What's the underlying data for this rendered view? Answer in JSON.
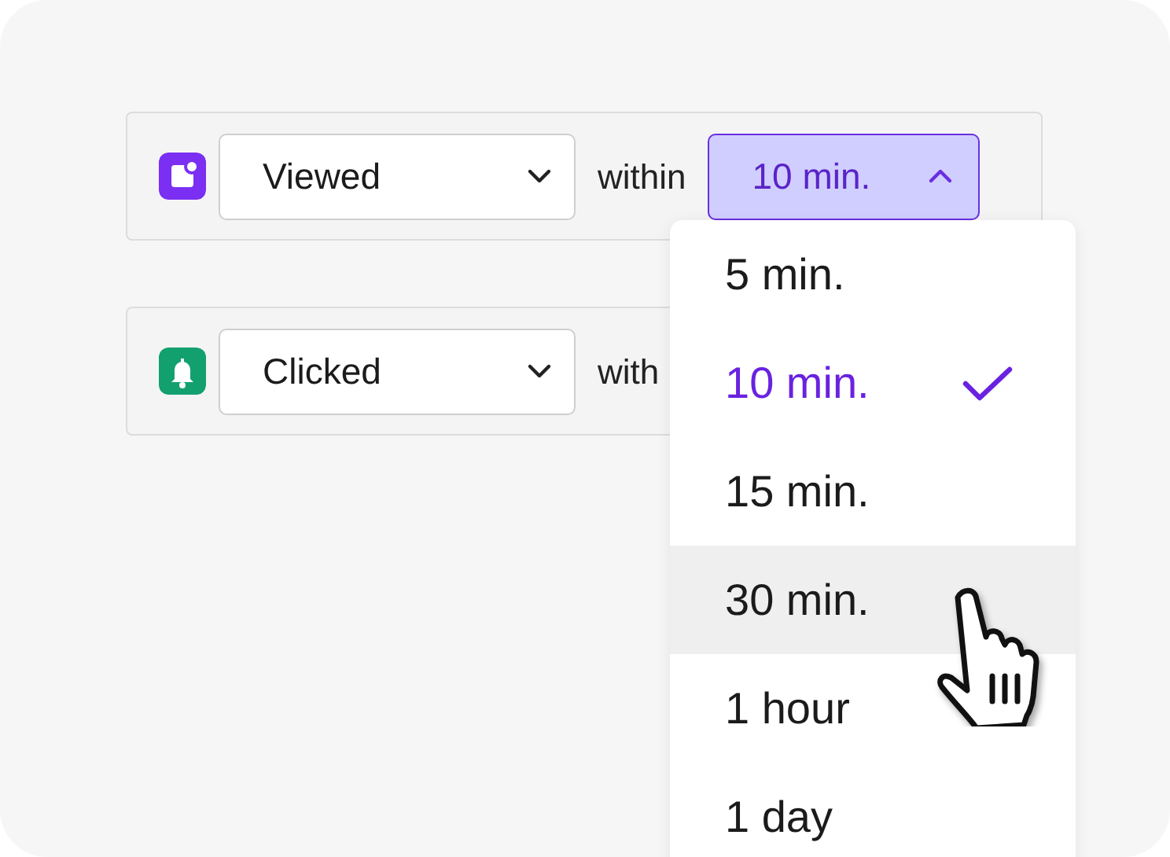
{
  "rows": [
    {
      "icon": {
        "kind": "message",
        "color": "#7b2ff2"
      },
      "event": "Viewed",
      "connector": "within",
      "duration": {
        "value": "10 min.",
        "open": true
      }
    },
    {
      "icon": {
        "kind": "bell",
        "color": "#13a06f"
      },
      "event": "Clicked",
      "connector": "with"
    }
  ],
  "menu": {
    "items": [
      {
        "label": "5 min.",
        "selected": false,
        "hovered": false
      },
      {
        "label": "10 min.",
        "selected": true,
        "hovered": false
      },
      {
        "label": "15 min.",
        "selected": false,
        "hovered": false
      },
      {
        "label": "30 min.",
        "selected": false,
        "hovered": true
      },
      {
        "label": "1 hour",
        "selected": false,
        "hovered": false
      },
      {
        "label": "1 day",
        "selected": false,
        "hovered": false
      }
    ]
  }
}
